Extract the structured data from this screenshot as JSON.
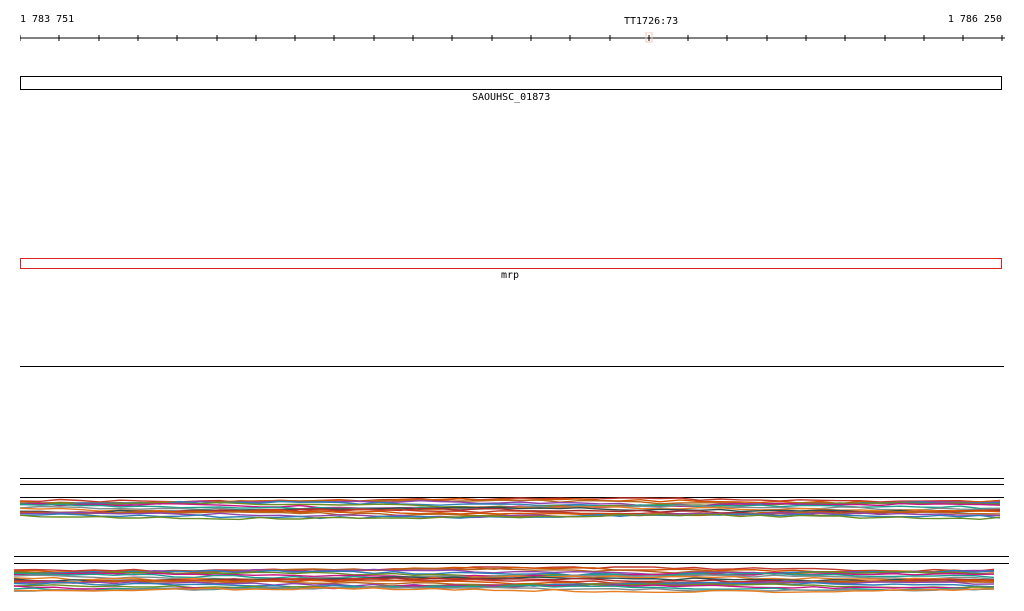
{
  "ruler": {
    "start": "1 783 751",
    "end": "1 786 250",
    "marker": "TT1726:73"
  },
  "features": {
    "gene": "SAOUHSC_01873",
    "mrp": "mrp"
  },
  "colors": {
    "gene_outline": "#000000",
    "mrp_outline": "#dd2222",
    "marker_highlight": "#f3c8b6",
    "alignment_palette": [
      "#c0392b",
      "#d35400",
      "#b5651d",
      "#8e44ad",
      "#2c7fb8",
      "#6a8e23",
      "#c71585",
      "#1f9e8f",
      "#7f8c8d",
      "#e67e22",
      "#2f4f4f",
      "#a52a2a"
    ]
  }
}
